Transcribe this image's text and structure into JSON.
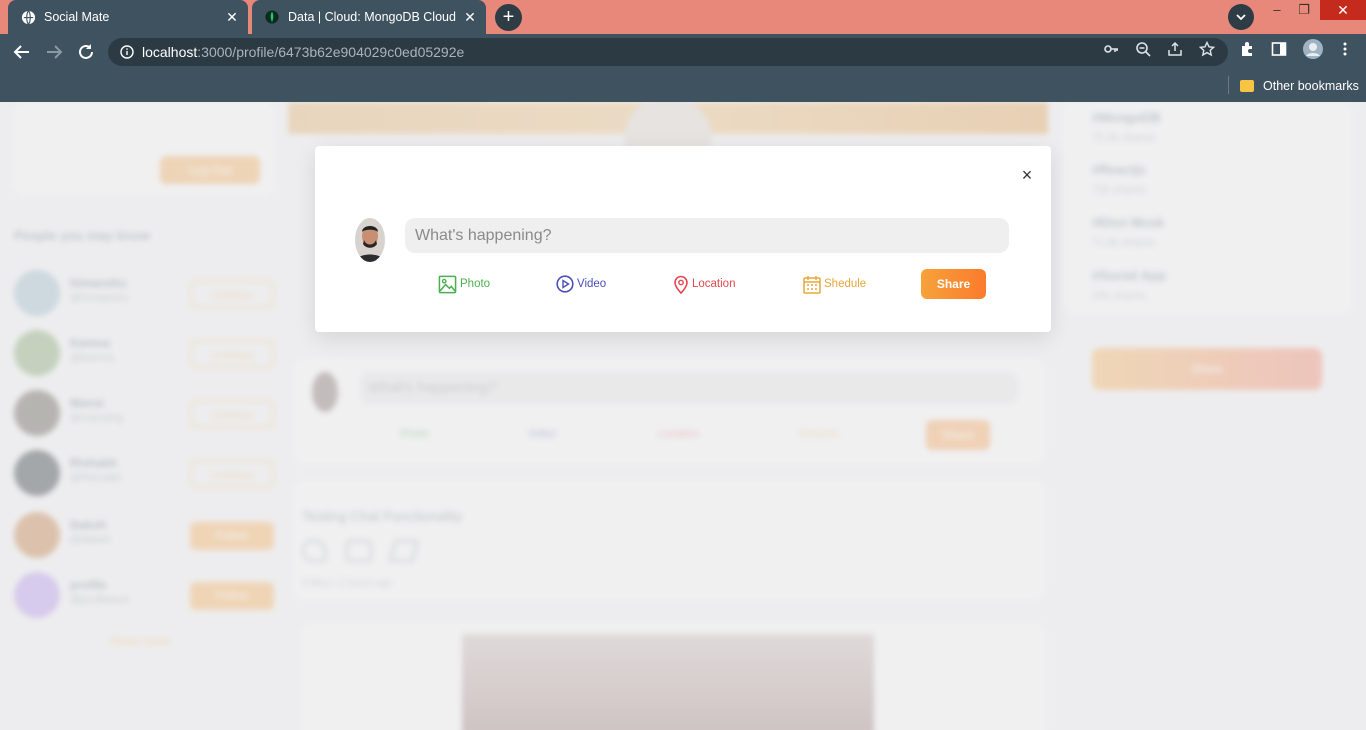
{
  "browser": {
    "tabs": [
      {
        "title": "Social Mate",
        "close": "✕"
      },
      {
        "title": "Data | Cloud: MongoDB Cloud",
        "close": "✕"
      }
    ],
    "new_tab": "+",
    "url_host": "localhost",
    "url_path": ":3000/profile/6473b62e904029c0ed05292e",
    "bookmarks_other": "Other bookmarks",
    "window_controls": {
      "minimize": "–",
      "restore": "❐",
      "close": "✕"
    }
  },
  "background": {
    "logout_label": "Log Out",
    "people_heading": "People you may know",
    "people": [
      {
        "name": "himanshu",
        "handle": "@himanshu",
        "action": "Unfollow"
      },
      {
        "name": "Kamna",
        "handle": "@kamna",
        "action": "Unfollow"
      },
      {
        "name": "Mansi",
        "handle": "@mansing",
        "action": "Unfollow"
      },
      {
        "name": "Rishabh",
        "handle": "@Rishabh",
        "action": "Unfollow"
      },
      {
        "name": "Daksh",
        "handle": "@daksh",
        "action": "Follow"
      },
      {
        "name": "profile",
        "handle": "@profiletest",
        "action": "Follow"
      }
    ],
    "show_more": "Show more",
    "trends": [
      {
        "tag": "#MongoDB",
        "shares": "75.5k shares"
      },
      {
        "tag": "#Reactjs",
        "shares": "72k shares"
      },
      {
        "tag": "#Elon Musk",
        "shares": "71.8k shares"
      },
      {
        "tag": "#Social App",
        "shares": "20k shares"
      }
    ],
    "right_share_label": "Share",
    "composer": {
      "placeholder": "What's happening?",
      "photo": "Photo",
      "video": "Video",
      "location": "Location",
      "schedule": "Shedule",
      "share": "Share"
    },
    "post": {
      "text": "Testing Chat Functionality",
      "meta": "0 likes • 2 hours ago"
    }
  },
  "modal": {
    "close": "×",
    "placeholder": "What's happening?",
    "options": {
      "photo": "Photo",
      "video": "Video",
      "location": "Location",
      "schedule": "Shedule"
    },
    "share": "Share",
    "colors": {
      "photo": "#4caf50",
      "video": "#4a4fb5",
      "location": "#e3474f",
      "schedule": "#e6a73a"
    }
  }
}
